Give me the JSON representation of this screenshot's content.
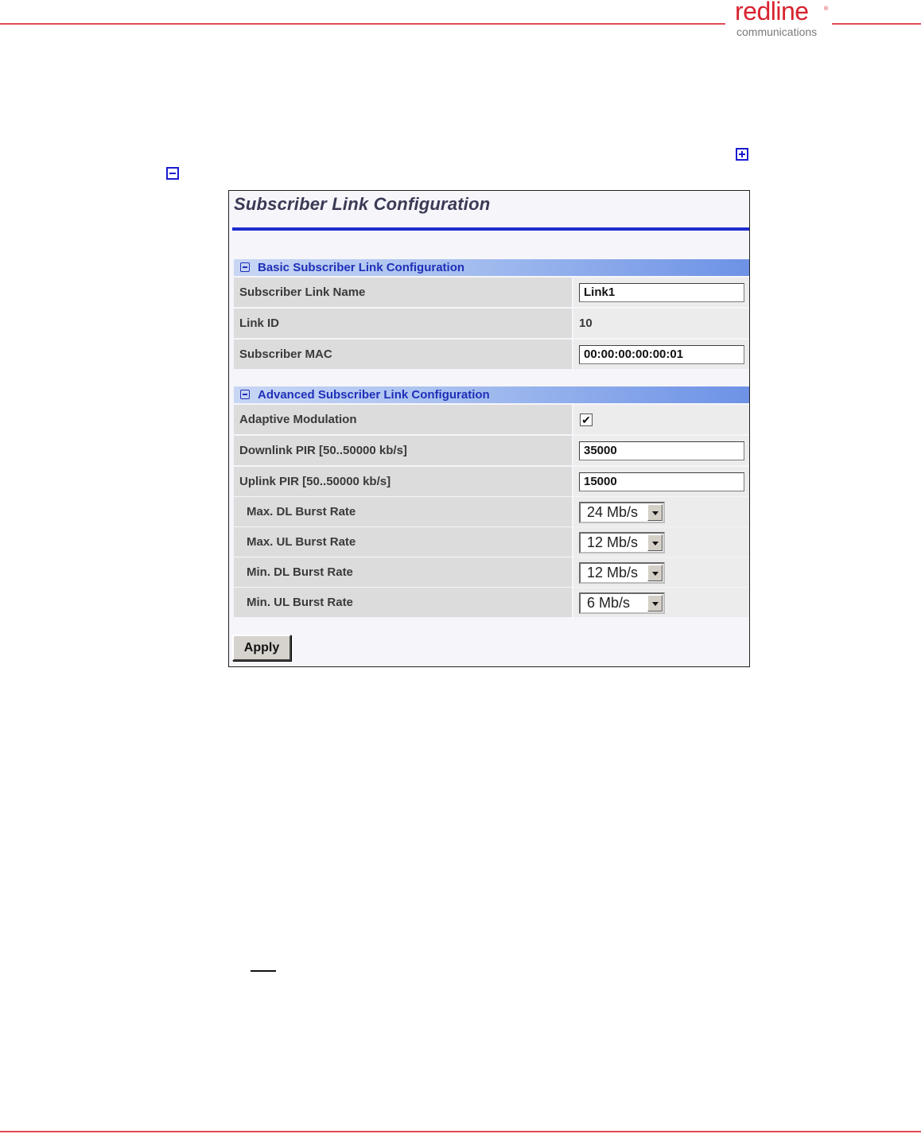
{
  "header": {
    "logo_text": "redline",
    "logo_registered": "®",
    "logo_subtext": "communications"
  },
  "panel": {
    "title": "Subscriber Link Configuration",
    "basic_section": {
      "header": "Basic Subscriber Link Configuration",
      "rows": [
        {
          "label": "Subscriber Link Name",
          "value": "Link1",
          "type": "text-input"
        },
        {
          "label": "Link ID",
          "value": "10",
          "type": "static"
        },
        {
          "label": "Subscriber MAC",
          "value": "00:00:00:00:00:01",
          "type": "text-input"
        }
      ]
    },
    "advanced_section": {
      "header": "Advanced Subscriber Link Configuration",
      "rows": [
        {
          "label": "Adaptive Modulation",
          "checked": true,
          "type": "checkbox"
        },
        {
          "label": "Downlink PIR [50..50000 kb/s]",
          "value": "35000",
          "type": "text-input"
        },
        {
          "label": "Uplink PIR [50..50000 kb/s]",
          "value": "15000",
          "type": "text-input"
        },
        {
          "label": "Max. DL Burst Rate",
          "value": "24 Mb/s",
          "type": "select"
        },
        {
          "label": "Max. UL Burst Rate",
          "value": "12 Mb/s",
          "type": "select"
        },
        {
          "label": "Min. DL Burst Rate",
          "value": "12 Mb/s",
          "type": "select"
        },
        {
          "label": "Min. UL Burst Rate",
          "value": "6 Mb/s",
          "type": "select"
        }
      ]
    },
    "apply_label": "Apply",
    "checkbox_glyph": "✔"
  },
  "icons": {
    "expand": "plus-box-icon",
    "collapse": "minus-box-icon"
  },
  "colors": {
    "rule": "#e04b55",
    "brand": "#d8232f",
    "accent": "#1e2bd0"
  }
}
